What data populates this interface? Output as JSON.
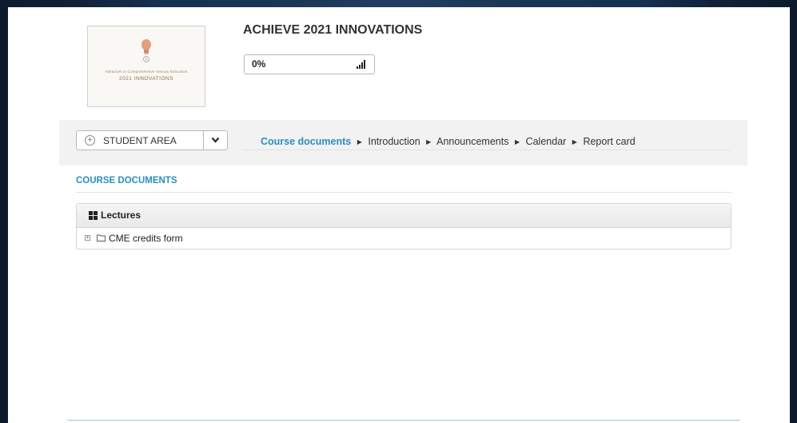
{
  "course": {
    "title": "ACHIEVE 2021 INNOVATIONS",
    "logo_subtitle": "Advances in Comprehensive Venous Education",
    "logo_title": "2021 INNOVATIONS"
  },
  "progress": {
    "label": "0%",
    "value": 0
  },
  "toolbar": {
    "student_area_label": "STUDENT AREA",
    "breadcrumbs": [
      "Course documents",
      "Introduction",
      "Announcements",
      "Calendar",
      "Report card"
    ]
  },
  "section": {
    "title": "COURSE DOCUMENTS"
  },
  "panel": {
    "title": "Lectures",
    "items": [
      {
        "label": "CME credits form"
      }
    ]
  },
  "colors": {
    "accent": "#2a8fbd"
  }
}
